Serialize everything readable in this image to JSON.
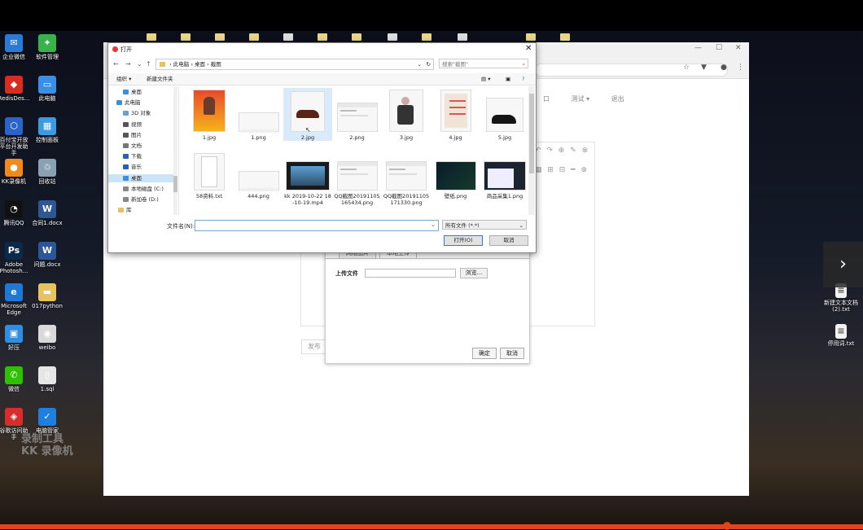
{
  "desktop_icons": [
    {
      "label": "企业微信",
      "icon": "wecom-icon",
      "color": "#2b7bd6"
    },
    {
      "label": "软件管理",
      "icon": "software-icon",
      "color": "#38b24a"
    },
    {
      "label": "RedisDes...",
      "icon": "redis-icon",
      "color": "#d82c20"
    },
    {
      "label": "此电脑",
      "icon": "computer-icon",
      "color": "#3a8ee6"
    },
    {
      "label": "百付宝开放平台开发助手",
      "icon": "app-icon",
      "color": "#2b63c9"
    },
    {
      "label": "控制面板",
      "icon": "control-panel-icon",
      "color": "#3c9be0"
    },
    {
      "label": "KK录像机",
      "icon": "kk-icon",
      "color": "#f08a1c"
    },
    {
      "label": "回收站",
      "icon": "recycle-bin-icon",
      "color": "#8aa0b3"
    },
    {
      "label": "腾讯QQ",
      "icon": "qq-icon",
      "color": "#111"
    },
    {
      "label": "合同1.docx",
      "icon": "word-icon",
      "color": "#2b5797"
    },
    {
      "label": "Adobe Photosh...",
      "icon": "photoshop-icon",
      "color": "#0b2a4a"
    },
    {
      "label": "问题.docx",
      "icon": "word-icon",
      "color": "#2b5797"
    },
    {
      "label": "Microsoft Edge",
      "icon": "edge-icon",
      "color": "#1e78d4"
    },
    {
      "label": "017python",
      "icon": "folder-icon",
      "color": "#e8c260"
    },
    {
      "label": "好压",
      "icon": "haozip-icon",
      "color": "#2f8ee0"
    },
    {
      "label": "weibo",
      "icon": "weibo-icon",
      "color": "#d9d9d9"
    },
    {
      "label": "微信",
      "icon": "wechat-icon",
      "color": "#2dc100"
    },
    {
      "label": "1.sql",
      "icon": "file-icon",
      "color": "#e6e6e6"
    },
    {
      "label": "谷歌访问助手",
      "icon": "chrome-helper-icon",
      "color": "#d92d2d"
    },
    {
      "label": "电脑管家",
      "icon": "security-icon",
      "color": "#1e7fe0"
    }
  ],
  "right_icons": [
    {
      "label": "新建文本文档 (2).txt",
      "icon": "txt-icon"
    },
    {
      "label": "停用词.txt",
      "icon": "txt-icon"
    }
  ],
  "watermark": {
    "line1": "录制工具",
    "line2": "KK 录像机"
  },
  "browser": {
    "menu": [
      "口",
      "测试 ▾",
      "退出"
    ],
    "publish": "发布",
    "upload_dialog": {
      "tab1": "网络图片",
      "tab2": "本地上传",
      "label": "上传文件",
      "browse": "浏览...",
      "ok": "确定",
      "cancel": "取消"
    }
  },
  "open_dialog": {
    "title": "打开",
    "breadcrumb": [
      "此电脑",
      "桌面",
      "截图"
    ],
    "search_placeholder": "搜索\"截图\"",
    "organize": "组织 ▾",
    "new_folder": "新建文件夹",
    "nav_items": [
      "桌面",
      "此电脑",
      "3D 对象",
      "视频",
      "图片",
      "文档",
      "下载",
      "音乐",
      "桌面",
      "本地磁盘 (C:)",
      "新加卷 (D:)",
      "库"
    ],
    "files": [
      {
        "name": "1.jpg",
        "kind": "poster"
      },
      {
        "name": "1.png",
        "kind": "blank"
      },
      {
        "name": "2.jpg",
        "kind": "shoe-brown"
      },
      {
        "name": "2.png",
        "kind": "screen"
      },
      {
        "name": "3.jpg",
        "kind": "person"
      },
      {
        "name": "4.jpg",
        "kind": "doc"
      },
      {
        "name": "5.jpg",
        "kind": "shoe-black"
      },
      {
        "name": "58资料.txt",
        "kind": "txt"
      },
      {
        "name": "444.png",
        "kind": "blank"
      },
      {
        "name": "kk 2019-10-22 18-10-19.mp4",
        "kind": "video"
      },
      {
        "name": "QQ截图20191105165434.png",
        "kind": "screen"
      },
      {
        "name": "QQ截图20191105171330.png",
        "kind": "screen"
      },
      {
        "name": "壁纸.png",
        "kind": "dark"
      },
      {
        "name": "商品采集1.png",
        "kind": "screen2"
      }
    ],
    "filename_label": "文件名(N):",
    "filetype": "所有文件 (*.*)",
    "open": "打开(O)",
    "cancel": "取消"
  }
}
